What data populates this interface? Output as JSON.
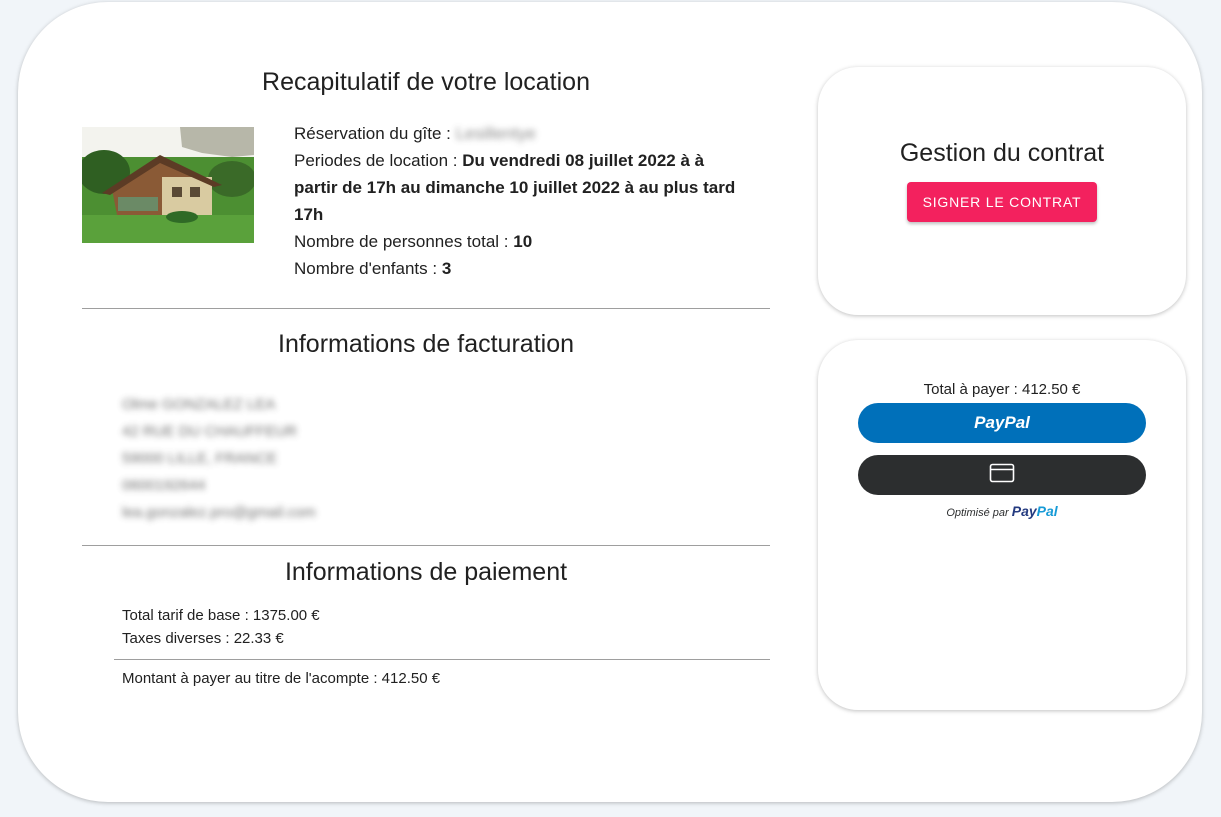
{
  "recap": {
    "title": "Recapitulatif de votre location",
    "gite_label": "Réservation du gîte : ",
    "gite_value": "Lesillentye",
    "periods_label": "Periodes de location : ",
    "periods_line1": "Du vendredi 08 juillet 2022 à à",
    "periods_line2": "partir de 17h au dimanche 10 juillet 2022 à au plus tard",
    "periods_line3": "17h",
    "people_label": "Nombre de personnes total : ",
    "people_value": "10",
    "children_label": "Nombre d'enfants : ",
    "children_value": "3"
  },
  "billing": {
    "title": "Informations de facturation",
    "lines": [
      "Olme GONZALEZ LEA",
      "42 RUE DU CHAUFFEUR",
      "59000 LILLE, FRANCE",
      "0600192644",
      "lea.gonzalez.pro@gmail.com"
    ]
  },
  "payment": {
    "title": "Informations de paiement",
    "base_rate": "Total tarif de base : 1375.00 €",
    "taxes": "Taxes diverses : 22.33 €",
    "deposit": "Montant à payer au titre de l'acompte : 412.50 €"
  },
  "contract": {
    "title": "Gestion du contrat",
    "sign_label": "SIGNER LE CONTRAT",
    "sign_color": "#f3215e"
  },
  "checkout": {
    "total_label": "Total à payer : 412.50 €",
    "paypal_label": "PayPal",
    "paypal_color": "#0070ba",
    "card_icon": "credit-card-icon",
    "card_color": "#2c2e2f",
    "powered_prefix": "Optimisé par",
    "powered_brand_1": "Pay",
    "powered_brand_2": "Pal"
  }
}
